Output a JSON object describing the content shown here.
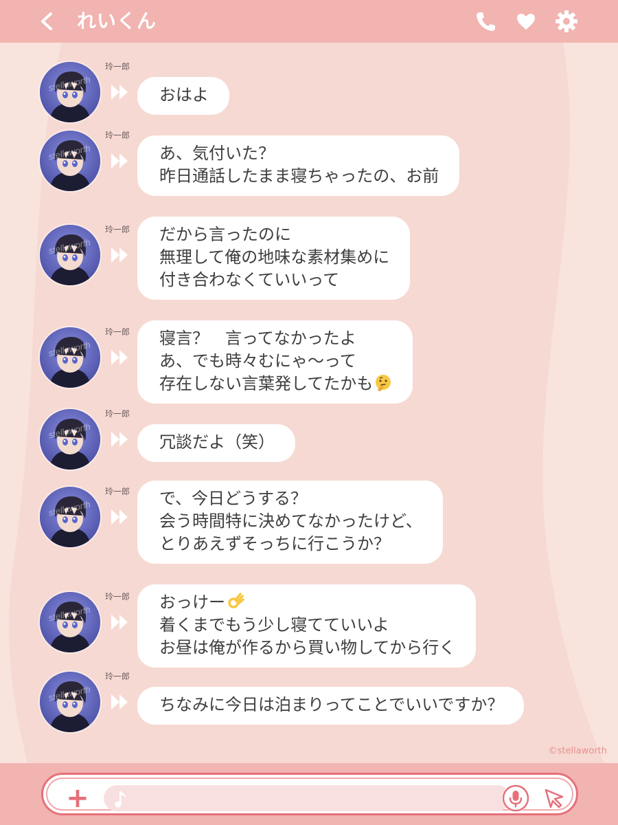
{
  "header": {
    "back_icon": "chevron-left-icon",
    "title": "れいくん",
    "icons": [
      "phone-icon",
      "heart-icon",
      "gear-icon"
    ]
  },
  "messages": [
    {
      "sender": "玲一郎",
      "text": "おはよ"
    },
    {
      "sender": "玲一郎",
      "text": "あ、気付いた？\n昨日通話したまま寝ちゃったの、お前"
    },
    {
      "sender": "玲一郎",
      "text": "だから言ったのに\n無理して俺の地味な素材集めに\n付き合わなくていいって"
    },
    {
      "sender": "玲一郎",
      "text": "寝言？　言ってなかったよ\nあ、でも時々むにゃ～って\n存在しない言葉発してたかも",
      "emoji": "thinking-face-emoji"
    },
    {
      "sender": "玲一郎",
      "text": "冗談だよ（笑）"
    },
    {
      "sender": "玲一郎",
      "text": "で、今日どうする？\n会う時間特に決めてなかったけど、\nとりあえずそっちに行こうか？"
    },
    {
      "sender": "玲一郎",
      "text": "おっけー\n着くまでもう少し寝てていいよ\nお昼は俺が作るから買い物してから行く",
      "emoji": "ok-hand-emoji"
    },
    {
      "sender": "玲一郎",
      "text": "ちなみに今日は泊まりってことでいいですか？"
    }
  ],
  "avatar_watermark": "stellaworth",
  "copyright": "©stellaworth",
  "input": {
    "plus_label": "+",
    "placeholder": "",
    "value": ""
  },
  "colors": {
    "header": "#f1b4b0",
    "background": "#f6d9d2",
    "accent": "#e5707a",
    "bubble": "#ffffff"
  }
}
